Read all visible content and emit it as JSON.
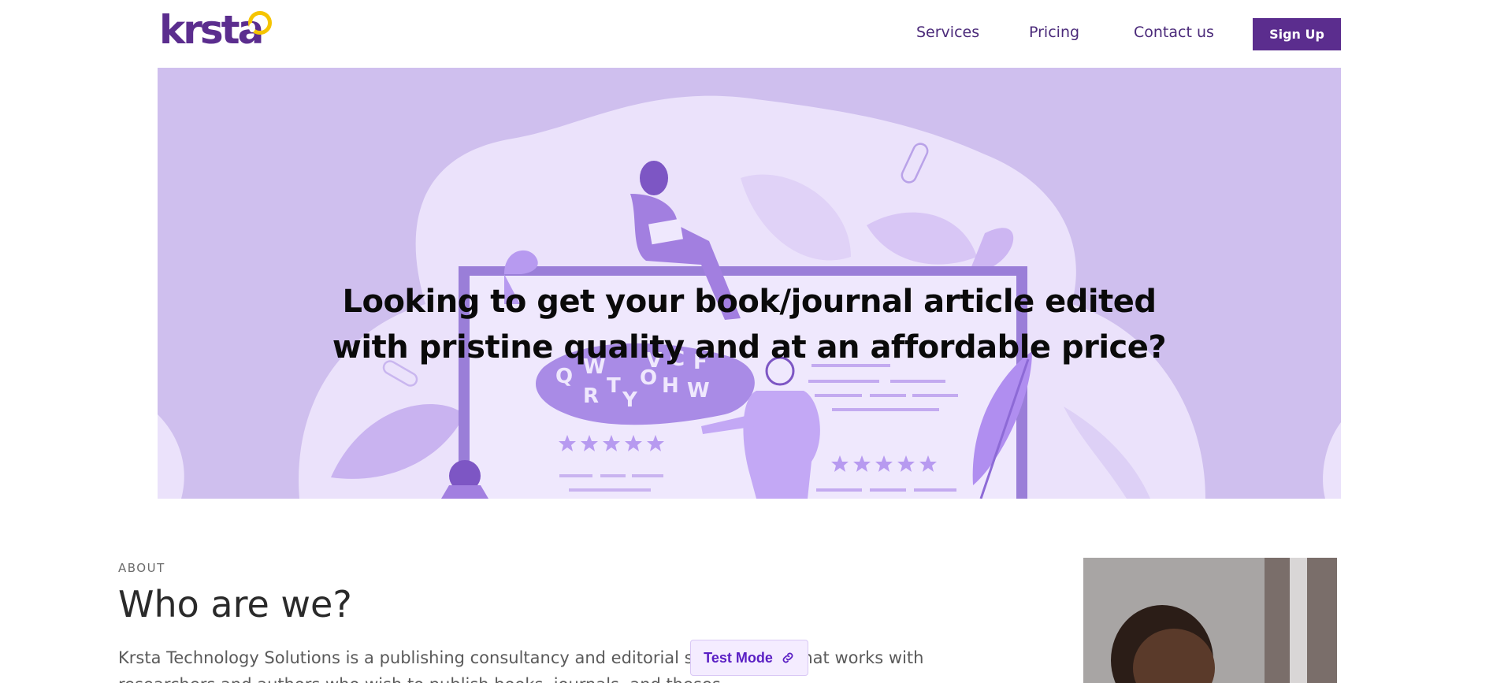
{
  "header": {
    "logo_text": "krsta",
    "nav": {
      "services": "Services",
      "pricing": "Pricing",
      "contact": "Contact us"
    },
    "signup_label": "Sign Up"
  },
  "hero": {
    "title_line1": "Looking to get your book/journal article edited",
    "title_line2": "with pristine quality and at an affordable price?",
    "illustration_letters": [
      "Q",
      "W",
      "V",
      "C",
      "F",
      "R",
      "T",
      "Y",
      "O",
      "H",
      "W"
    ]
  },
  "about": {
    "label": "ABOUT",
    "title": "Who are we?",
    "text": "Krsta Technology Solutions is a publishing consultancy and editorial services firm that works with researchers and authors who wish to publish books, journals, and theses."
  },
  "test_mode": {
    "label": "Test Mode",
    "icon": "link-icon"
  },
  "colors": {
    "brand": "#5b2d8e",
    "hero_bg": "#cfbfee",
    "logo_accent": "#f5c400"
  }
}
